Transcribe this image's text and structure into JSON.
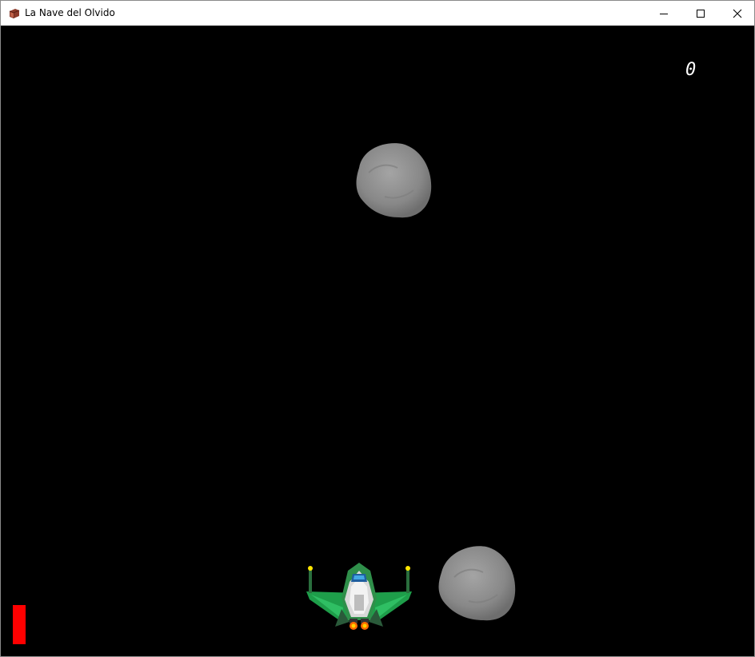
{
  "window": {
    "title": "La Nave del Olvido",
    "icon": "book-icon",
    "controls": [
      "minimize-icon",
      "maximize-icon",
      "close-icon"
    ]
  },
  "game": {
    "score": "0",
    "health_fraction": 1.0,
    "colors": {
      "background": "#000000",
      "health_bar": "#ff0000",
      "score_text": "#ffffff",
      "ship_wings": "#1e9e4a",
      "asteroid": "#8c8c8c"
    },
    "sprites": [
      "spaceship",
      "asteroid",
      "asteroid"
    ]
  }
}
